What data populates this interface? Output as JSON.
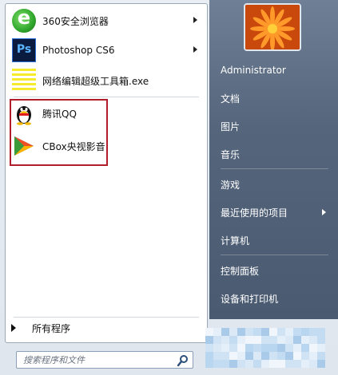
{
  "programs": [
    {
      "label": "360安全浏览器",
      "icon": "browser-icon",
      "has_submenu": true
    },
    {
      "label": "Photoshop CS6",
      "icon": "photoshop-icon",
      "has_submenu": true
    },
    {
      "label": "网络编辑超级工具箱.exe",
      "icon": "exe-icon",
      "has_submenu": false
    },
    {
      "label": "腾讯QQ",
      "icon": "qq-penguin-icon",
      "has_submenu": false
    },
    {
      "label": "CBox央视影音",
      "icon": "cbox-icon",
      "has_submenu": false
    }
  ],
  "all_programs_label": "所有程序",
  "search": {
    "placeholder": "搜索程序和文件"
  },
  "right_menu": {
    "user_name": "Administrator",
    "items": [
      {
        "label": "文档"
      },
      {
        "label": "图片"
      },
      {
        "label": "音乐"
      },
      {
        "label": "游戏"
      },
      {
        "label": "最近使用的项目",
        "has_submenu": true
      },
      {
        "label": "计算机"
      },
      {
        "label": "控制面板"
      },
      {
        "label": "设备和打印机"
      }
    ]
  },
  "colors": {
    "highlight_border": "#b11d2a",
    "right_pane": "#55657b",
    "search_border": "#8aa0b8"
  }
}
